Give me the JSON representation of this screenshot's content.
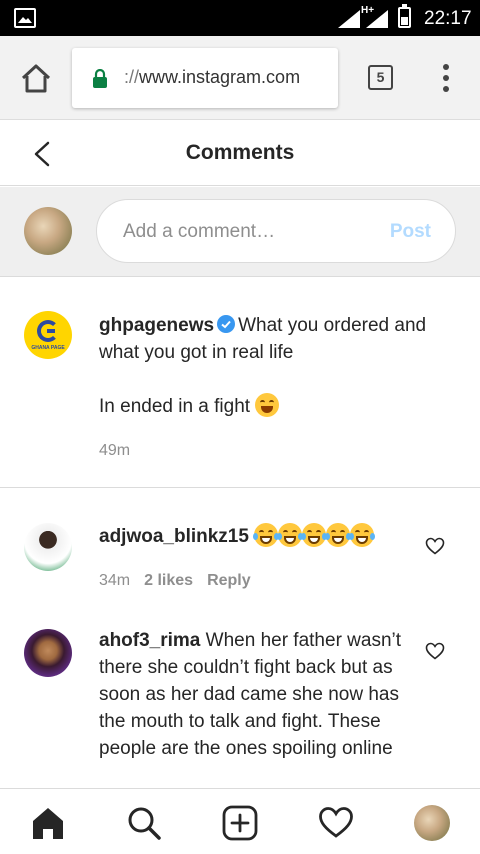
{
  "status_bar": {
    "time": "22:17",
    "network": "H+"
  },
  "browser": {
    "url_scheme": "://",
    "url_host": "www.instagram.com",
    "tab_count": "5"
  },
  "header": {
    "title": "Comments"
  },
  "add_comment": {
    "placeholder": "Add a comment…",
    "post_label": "Post"
  },
  "caption": {
    "username": "ghpagenews",
    "avatar_text": "GHANA PAGE",
    "text": "What you ordered and what you got in real life",
    "line2": "In ended in a fight",
    "time": "49m"
  },
  "comments": [
    {
      "username": "adjwoa_blinkz15",
      "text": "",
      "emoji_count": 5,
      "time": "34m",
      "likes": "2 likes",
      "reply": "Reply"
    },
    {
      "username": "ahof3_rima",
      "text": "When her father wasn’t there she couldn’t fight back but as soon as her dad came she now has the mouth to talk and fight. These people are the ones spoiling online"
    }
  ],
  "colors": {
    "accent_post": "#b3dbff",
    "verified": "#3897f0",
    "lock": "#0b8043",
    "ghpage_yellow": "#ffd500"
  },
  "icons": [
    "home-icon",
    "search-icon",
    "add-post-icon",
    "heart-icon",
    "profile-avatar"
  ]
}
